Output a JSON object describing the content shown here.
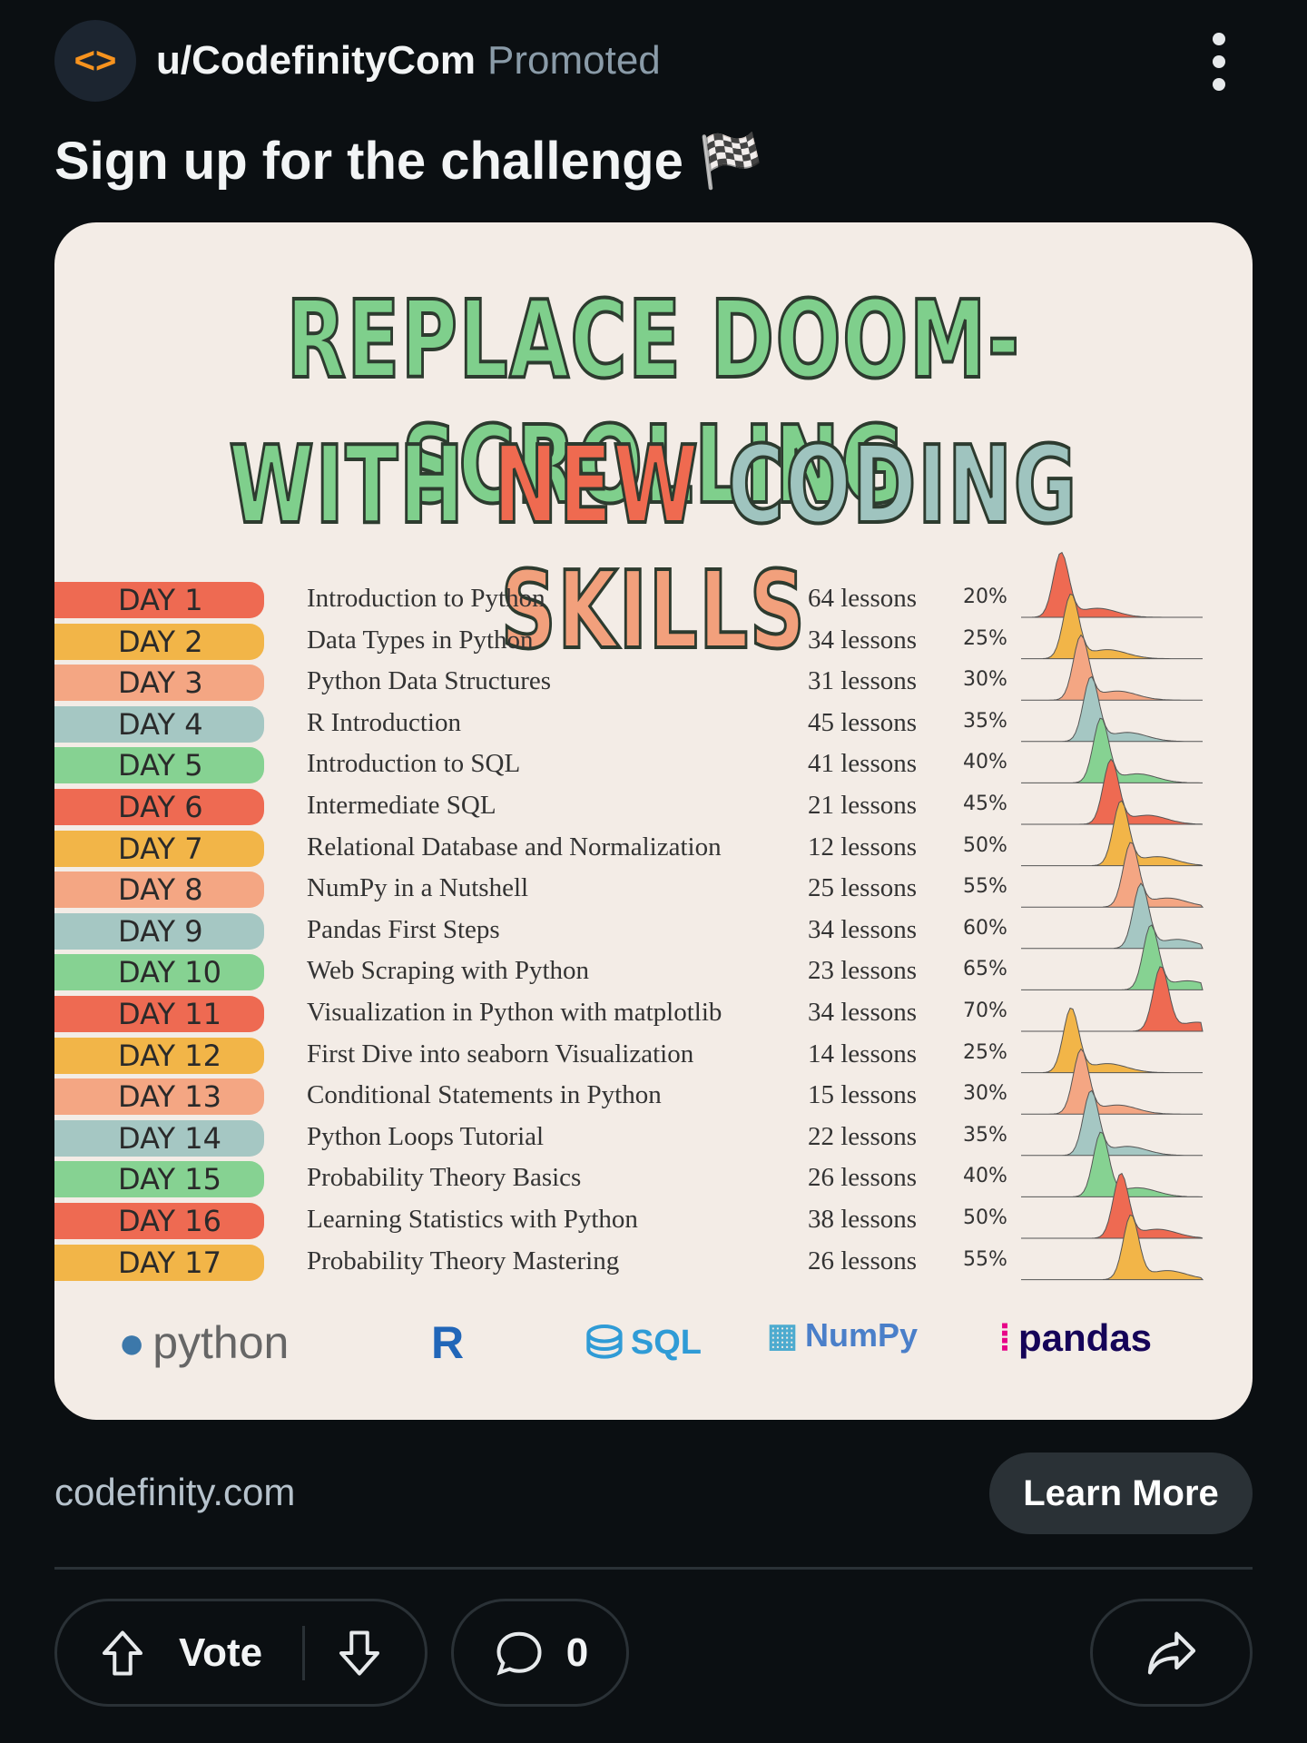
{
  "post": {
    "username": "u/CodefinityCom",
    "promoted": "Promoted",
    "title": "Sign up for the challenge 🏁",
    "more_icon": "more-vertical-icon",
    "avatar_icon": "code-brackets-icon"
  },
  "image": {
    "headline_line1": "REPLACE DOOM-SCROLLING",
    "headline_line2_parts": [
      {
        "text": "WITH ",
        "color": "#7fcf8c"
      },
      {
        "text": "NEW ",
        "color": "#ef6a50"
      },
      {
        "text": "CODING ",
        "color": "#9fc4bf"
      },
      {
        "text": "SKILLS",
        "color": "#f2a07c"
      }
    ],
    "rows": [
      {
        "day": "DAY 1",
        "course": "Introduction to Python",
        "lessons": "64 lessons",
        "percent": "20%",
        "color": "#ee6a52"
      },
      {
        "day": "DAY 2",
        "course": "Data Types in Python",
        "lessons": "34 lessons",
        "percent": "25%",
        "color": "#f2b548"
      },
      {
        "day": "DAY 3",
        "course": "Python Data Structures",
        "lessons": "31 lessons",
        "percent": "30%",
        "color": "#f4a683"
      },
      {
        "day": "DAY 4",
        "course": "R Introduction",
        "lessons": "45 lessons",
        "percent": "35%",
        "color": "#a5c7c3"
      },
      {
        "day": "DAY 5",
        "course": "Introduction to SQL",
        "lessons": "41 lessons",
        "percent": "40%",
        "color": "#86d292"
      },
      {
        "day": "DAY 6",
        "course": "Intermediate SQL",
        "lessons": "21 lessons",
        "percent": "45%",
        "color": "#ee6a52"
      },
      {
        "day": "DAY 7",
        "course": "Relational Database and Normalization",
        "lessons": "12 lessons",
        "percent": "50%",
        "color": "#f2b548"
      },
      {
        "day": "DAY 8",
        "course": "NumPy in a Nutshell",
        "lessons": "25 lessons",
        "percent": "55%",
        "color": "#f4a683"
      },
      {
        "day": "DAY 9",
        "course": "Pandas First Steps",
        "lessons": "34 lessons",
        "percent": "60%",
        "color": "#a5c7c3"
      },
      {
        "day": "DAY 10",
        "course": "Web Scraping with Python",
        "lessons": "23 lessons",
        "percent": "65%",
        "color": "#86d292"
      },
      {
        "day": "DAY 11",
        "course": "Visualization in Python with matplotlib",
        "lessons": "34 lessons",
        "percent": "70%",
        "color": "#ee6a52"
      },
      {
        "day": "DAY 12",
        "course": "First Dive into seaborn Visualization",
        "lessons": "14 lessons",
        "percent": "25%",
        "color": "#f2b548"
      },
      {
        "day": "DAY 13",
        "course": "Conditional Statements in Python",
        "lessons": "15 lessons",
        "percent": "30%",
        "color": "#f4a683"
      },
      {
        "day": "DAY 14",
        "course": "Python Loops Tutorial",
        "lessons": "22 lessons",
        "percent": "35%",
        "color": "#a5c7c3"
      },
      {
        "day": "DAY 15",
        "course": "Probability Theory Basics",
        "lessons": "26 lessons",
        "percent": "40%",
        "color": "#86d292"
      },
      {
        "day": "DAY 16",
        "course": "Learning Statistics with Python",
        "lessons": "38 lessons",
        "percent": "50%",
        "color": "#ee6a52"
      },
      {
        "day": "DAY 17",
        "course": "Probability Theory Mastering",
        "lessons": "26 lessons",
        "percent": "55%",
        "color": "#f2b548"
      }
    ],
    "logos": {
      "python": "python",
      "r": "R",
      "sql": "SQL",
      "numpy": "NumPy",
      "pandas": "pandas"
    }
  },
  "footer": {
    "site": "codefinity.com",
    "cta": "Learn More",
    "vote": "Vote",
    "comments": "0"
  }
}
